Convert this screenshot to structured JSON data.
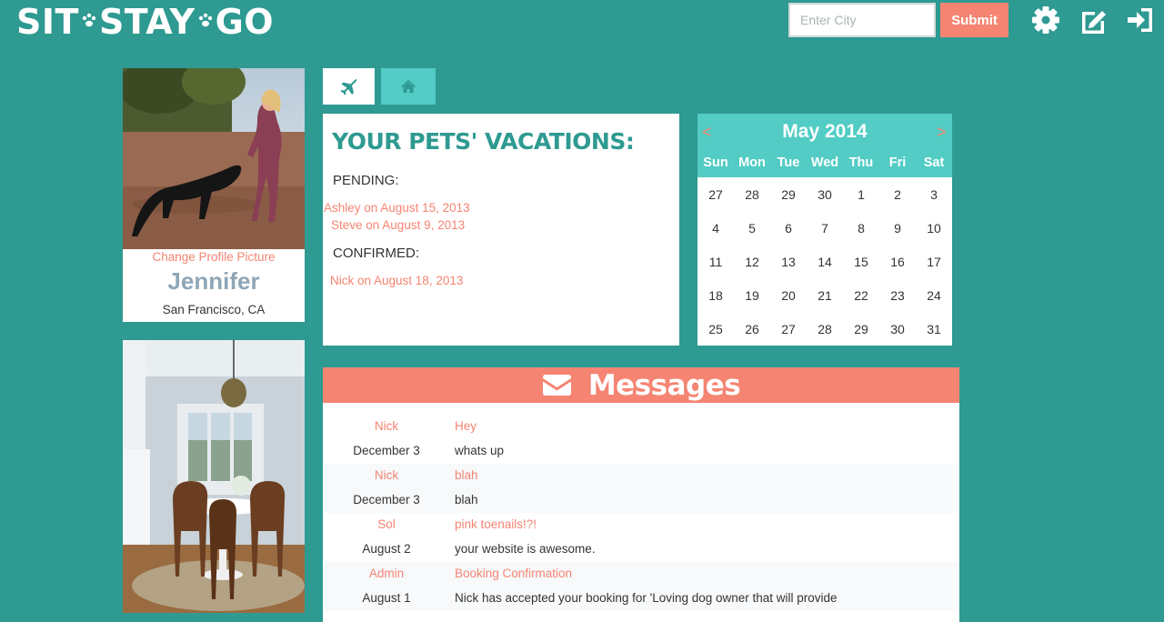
{
  "header": {
    "logo": [
      "SIT",
      "STAY",
      "GO"
    ],
    "city_placeholder": "Enter City",
    "city_value": "",
    "submit_label": "Submit",
    "icons": [
      "gear-icon",
      "edit-icon",
      "sign-out-icon"
    ]
  },
  "colors": {
    "background": "#2e9a91",
    "accent": "#f58472",
    "light_teal": "#52ccc4",
    "name": "#8fa6b6"
  },
  "profile": {
    "change_picture": "Change Profile Picture",
    "name": "Jennifer",
    "location": "San Francisco, CA"
  },
  "tabs": [
    {
      "icon": "plane-icon",
      "active": true
    },
    {
      "icon": "home-icon",
      "active": false
    }
  ],
  "vacations": {
    "title": "YOUR PETS' VACATIONS:",
    "pending_label": "PENDING:",
    "pending": [
      "Ashley on August 15, 2013",
      "Steve on August 9, 2013"
    ],
    "confirmed_label": "CONFIRMED:",
    "confirmed": [
      "Nick on August 18, 2013"
    ]
  },
  "calendar": {
    "month": "May 2014",
    "prev": "<",
    "next": ">",
    "weekdays": [
      "Sun",
      "Mon",
      "Tue",
      "Wed",
      "Thu",
      "Fri",
      "Sat"
    ],
    "weeks": [
      [
        "27",
        "28",
        "29",
        "30",
        "1",
        "2",
        "3"
      ],
      [
        "4",
        "5",
        "6",
        "7",
        "8",
        "9",
        "10"
      ],
      [
        "11",
        "12",
        "13",
        "14",
        "15",
        "16",
        "17"
      ],
      [
        "18",
        "19",
        "20",
        "21",
        "22",
        "23",
        "24"
      ],
      [
        "25",
        "26",
        "27",
        "28",
        "29",
        "30",
        "31"
      ]
    ]
  },
  "messages": {
    "title": "Messages",
    "items": [
      {
        "from": "Nick",
        "date": "December 3",
        "subject": "Hey",
        "body": "whats up"
      },
      {
        "from": "Nick",
        "date": "December 3",
        "subject": "blah",
        "body": "blah"
      },
      {
        "from": "Sol",
        "date": "August 2",
        "subject": "pink toenails!?!",
        "body": "your website is awesome."
      },
      {
        "from": "Admin",
        "date": "August 1",
        "subject": "Booking Confirmation",
        "body": "Nick has accepted your booking for 'Loving dog owner that will provide"
      }
    ]
  }
}
